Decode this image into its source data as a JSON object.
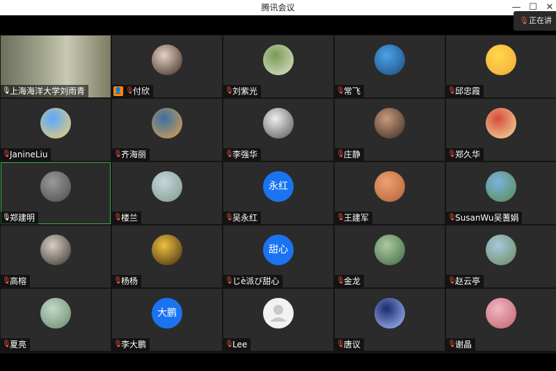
{
  "window": {
    "title": "腾讯会议",
    "min_icon": "minimize-icon",
    "max_icon": "maximize-icon",
    "close_icon": "close-icon"
  },
  "speaking": {
    "label": "正在讲",
    "icon": "mic-muted-icon"
  },
  "colors": {
    "muted": "#ff5a4a",
    "host_badge": "#ff8a00",
    "text_avatar": "#1a74f2",
    "active_border": "#2fb344"
  },
  "participants": [
    {
      "name": "上海海洋大学刘雨青",
      "avatar_type": "video",
      "mic": "on"
    },
    {
      "name": "付欣",
      "avatar_type": "photo",
      "mic": "muted",
      "host": true
    },
    {
      "name": "刘紫光",
      "avatar_type": "photo",
      "mic": "muted"
    },
    {
      "name": "常飞",
      "avatar_type": "photo",
      "mic": "muted"
    },
    {
      "name": "邱忠霞",
      "avatar_type": "photo",
      "mic": "muted"
    },
    {
      "name": "JanineLiu",
      "avatar_type": "photo",
      "mic": "muted"
    },
    {
      "name": "齐海丽",
      "avatar_type": "photo",
      "mic": "muted"
    },
    {
      "name": "李强华",
      "avatar_type": "photo",
      "mic": "muted"
    },
    {
      "name": "庄静",
      "avatar_type": "photo",
      "mic": "muted"
    },
    {
      "name": "郑久华",
      "avatar_type": "photo",
      "mic": "muted"
    },
    {
      "name": "郑建明",
      "avatar_type": "photo",
      "mic": "on",
      "active": true
    },
    {
      "name": "楼兰",
      "avatar_type": "photo",
      "mic": "muted"
    },
    {
      "name": "吴永红",
      "avatar_type": "text",
      "avatar_text": "永红",
      "mic": "muted"
    },
    {
      "name": "王建军",
      "avatar_type": "photo",
      "mic": "muted"
    },
    {
      "name": "SusanWu吴蓍娟",
      "avatar_type": "photo",
      "mic": "muted"
    },
    {
      "name": "高榕",
      "avatar_type": "photo",
      "mic": "muted"
    },
    {
      "name": "杨杨",
      "avatar_type": "photo",
      "mic": "muted"
    },
    {
      "name": "じè派び甜心",
      "avatar_type": "text",
      "avatar_text": "甜心",
      "mic": "muted"
    },
    {
      "name": "金龙",
      "avatar_type": "photo",
      "mic": "muted"
    },
    {
      "name": "赵云亭",
      "avatar_type": "photo",
      "mic": "muted"
    },
    {
      "name": "夏亮",
      "avatar_type": "photo",
      "mic": "muted"
    },
    {
      "name": "李大鹏",
      "avatar_type": "text",
      "avatar_text": "大鹏",
      "mic": "muted"
    },
    {
      "name": "Lee",
      "avatar_type": "default",
      "mic": "muted"
    },
    {
      "name": "唐议",
      "avatar_type": "photo",
      "mic": "muted"
    },
    {
      "name": "谢晶",
      "avatar_type": "photo",
      "mic": "muted"
    }
  ]
}
